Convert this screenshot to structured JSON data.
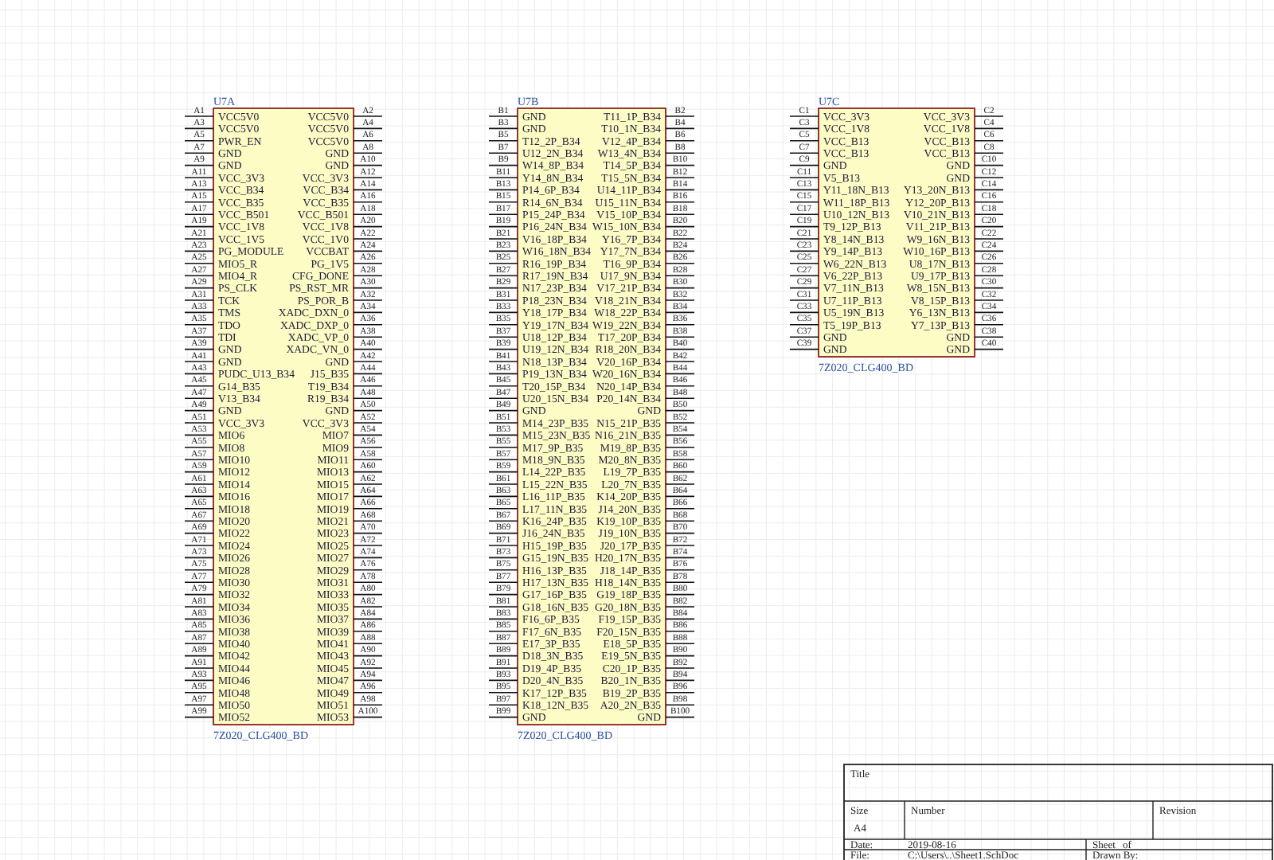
{
  "parts": [
    {
      "designator": "U7A",
      "footprint": "7Z020_CLG400_BD",
      "rows": [
        {
          "pin_l": "A1",
          "name_l": "VCC5V0",
          "name_r": "VCC5V0",
          "pin_r": "A2"
        },
        {
          "pin_l": "A3",
          "name_l": "VCC5V0",
          "name_r": "VCC5V0",
          "pin_r": "A4"
        },
        {
          "pin_l": "A5",
          "name_l": "PWR_EN",
          "name_r": "VCC5V0",
          "pin_r": "A6"
        },
        {
          "pin_l": "A7",
          "name_l": "GND",
          "name_r": "GND",
          "pin_r": "A8"
        },
        {
          "pin_l": "A9",
          "name_l": "GND",
          "name_r": "GND",
          "pin_r": "A10"
        },
        {
          "pin_l": "A11",
          "name_l": "VCC_3V3",
          "name_r": "VCC_3V3",
          "pin_r": "A12"
        },
        {
          "pin_l": "A13",
          "name_l": "VCC_B34",
          "name_r": "VCC_B34",
          "pin_r": "A14"
        },
        {
          "pin_l": "A15",
          "name_l": "VCC_B35",
          "name_r": "VCC_B35",
          "pin_r": "A16"
        },
        {
          "pin_l": "A17",
          "name_l": "VCC_B501",
          "name_r": "VCC_B501",
          "pin_r": "A18"
        },
        {
          "pin_l": "A19",
          "name_l": "VCC_1V8",
          "name_r": "VCC_1V8",
          "pin_r": "A20"
        },
        {
          "pin_l": "A21",
          "name_l": "VCC_1V5",
          "name_r": "VCC_1V0",
          "pin_r": "A22"
        },
        {
          "pin_l": "A23",
          "name_l": "PG_MODULE",
          "name_r": "VCCBAT",
          "pin_r": "A24"
        },
        {
          "pin_l": "A25",
          "name_l": "MIO5_R",
          "name_r": "PG_1V5",
          "pin_r": "A26"
        },
        {
          "pin_l": "A27",
          "name_l": "MIO4_R",
          "name_r": "CFG_DONE",
          "pin_r": "A28"
        },
        {
          "pin_l": "A29",
          "name_l": "PS_CLK",
          "name_r": "PS_RST_MR",
          "pin_r": "A30"
        },
        {
          "pin_l": "A31",
          "name_l": "TCK",
          "name_r": "PS_POR_B",
          "pin_r": "A32"
        },
        {
          "pin_l": "A33",
          "name_l": "TMS",
          "name_r": "XADC_DXN_0",
          "pin_r": "A34"
        },
        {
          "pin_l": "A35",
          "name_l": "TDO",
          "name_r": "XADC_DXP_0",
          "pin_r": "A36"
        },
        {
          "pin_l": "A37",
          "name_l": "TDI",
          "name_r": "XADC_VP_0",
          "pin_r": "A38"
        },
        {
          "pin_l": "A39",
          "name_l": "GND",
          "name_r": "XADC_VN_0",
          "pin_r": "A40"
        },
        {
          "pin_l": "A41",
          "name_l": "GND",
          "name_r": "GND",
          "pin_r": "A42"
        },
        {
          "pin_l": "A43",
          "name_l": "PUDC_U13_B34",
          "name_r": "J15_B35",
          "pin_r": "A44"
        },
        {
          "pin_l": "A45",
          "name_l": "G14_B35",
          "name_r": "T19_B34",
          "pin_r": "A46"
        },
        {
          "pin_l": "A47",
          "name_l": "V13_B34",
          "name_r": "R19_B34",
          "pin_r": "A48"
        },
        {
          "pin_l": "A49",
          "name_l": "GND",
          "name_r": "GND",
          "pin_r": "A50"
        },
        {
          "pin_l": "A51",
          "name_l": "VCC_3V3",
          "name_r": "VCC_3V3",
          "pin_r": "A52"
        },
        {
          "pin_l": "A53",
          "name_l": "MIO6",
          "name_r": "MIO7",
          "pin_r": "A54"
        },
        {
          "pin_l": "A55",
          "name_l": "MIO8",
          "name_r": "MIO9",
          "pin_r": "A56"
        },
        {
          "pin_l": "A57",
          "name_l": "MIO10",
          "name_r": "MIO11",
          "pin_r": "A58"
        },
        {
          "pin_l": "A59",
          "name_l": "MIO12",
          "name_r": "MIO13",
          "pin_r": "A60"
        },
        {
          "pin_l": "A61",
          "name_l": "MIO14",
          "name_r": "MIO15",
          "pin_r": "A62"
        },
        {
          "pin_l": "A63",
          "name_l": "MIO16",
          "name_r": "MIO17",
          "pin_r": "A64"
        },
        {
          "pin_l": "A65",
          "name_l": "MIO18",
          "name_r": "MIO19",
          "pin_r": "A66"
        },
        {
          "pin_l": "A67",
          "name_l": "MIO20",
          "name_r": "MIO21",
          "pin_r": "A68"
        },
        {
          "pin_l": "A69",
          "name_l": "MIO22",
          "name_r": "MIO23",
          "pin_r": "A70"
        },
        {
          "pin_l": "A71",
          "name_l": "MIO24",
          "name_r": "MIO25",
          "pin_r": "A72"
        },
        {
          "pin_l": "A73",
          "name_l": "MIO26",
          "name_r": "MIO27",
          "pin_r": "A74"
        },
        {
          "pin_l": "A75",
          "name_l": "MIO28",
          "name_r": "MIO29",
          "pin_r": "A76"
        },
        {
          "pin_l": "A77",
          "name_l": "MIO30",
          "name_r": "MIO31",
          "pin_r": "A78"
        },
        {
          "pin_l": "A79",
          "name_l": "MIO32",
          "name_r": "MIO33",
          "pin_r": "A80"
        },
        {
          "pin_l": "A81",
          "name_l": "MIO34",
          "name_r": "MIO35",
          "pin_r": "A82"
        },
        {
          "pin_l": "A83",
          "name_l": "MIO36",
          "name_r": "MIO37",
          "pin_r": "A84"
        },
        {
          "pin_l": "A85",
          "name_l": "MIO38",
          "name_r": "MIO39",
          "pin_r": "A86"
        },
        {
          "pin_l": "A87",
          "name_l": "MIO40",
          "name_r": "MIO41",
          "pin_r": "A88"
        },
        {
          "pin_l": "A89",
          "name_l": "MIO42",
          "name_r": "MIO43",
          "pin_r": "A90"
        },
        {
          "pin_l": "A91",
          "name_l": "MIO44",
          "name_r": "MIO45",
          "pin_r": "A92"
        },
        {
          "pin_l": "A93",
          "name_l": "MIO46",
          "name_r": "MIO47",
          "pin_r": "A94"
        },
        {
          "pin_l": "A95",
          "name_l": "MIO48",
          "name_r": "MIO49",
          "pin_r": "A96"
        },
        {
          "pin_l": "A97",
          "name_l": "MIO50",
          "name_r": "MIO51",
          "pin_r": "A98"
        },
        {
          "pin_l": "A99",
          "name_l": "MIO52",
          "name_r": "MIO53",
          "pin_r": "A100"
        }
      ]
    },
    {
      "designator": "U7B",
      "footprint": "7Z020_CLG400_BD",
      "rows": [
        {
          "pin_l": "B1",
          "name_l": "GND",
          "name_r": "T11_1P_B34",
          "pin_r": "B2"
        },
        {
          "pin_l": "B3",
          "name_l": "GND",
          "name_r": "T10_1N_B34",
          "pin_r": "B4"
        },
        {
          "pin_l": "B5",
          "name_l": "T12_2P_B34",
          "name_r": "V12_4P_B34",
          "pin_r": "B6"
        },
        {
          "pin_l": "B7",
          "name_l": "U12_2N_B34",
          "name_r": "W13_4N_B34",
          "pin_r": "B8"
        },
        {
          "pin_l": "B9",
          "name_l": "W14_8P_B34",
          "name_r": "T14_5P_B34",
          "pin_r": "B10"
        },
        {
          "pin_l": "B11",
          "name_l": "Y14_8N_B34",
          "name_r": "T15_5N_B34",
          "pin_r": "B12"
        },
        {
          "pin_l": "B13",
          "name_l": "P14_6P_B34",
          "name_r": "U14_11P_B34",
          "pin_r": "B14"
        },
        {
          "pin_l": "B15",
          "name_l": "R14_6N_B34",
          "name_r": "U15_11N_B34",
          "pin_r": "B16"
        },
        {
          "pin_l": "B17",
          "name_l": "P15_24P_B34",
          "name_r": "V15_10P_B34",
          "pin_r": "B18"
        },
        {
          "pin_l": "B19",
          "name_l": "P16_24N_B34",
          "name_r": "W15_10N_B34",
          "pin_r": "B20"
        },
        {
          "pin_l": "B21",
          "name_l": "V16_18P_B34",
          "name_r": "Y16_7P_B34",
          "pin_r": "B22"
        },
        {
          "pin_l": "B23",
          "name_l": "W16_18N_B34",
          "name_r": "Y17_7N_B34",
          "pin_r": "B24"
        },
        {
          "pin_l": "B25",
          "name_l": "R16_19P_B34",
          "name_r": "T16_9P_B34",
          "pin_r": "B26"
        },
        {
          "pin_l": "B27",
          "name_l": "R17_19N_B34",
          "name_r": "U17_9N_B34",
          "pin_r": "B28"
        },
        {
          "pin_l": "B29",
          "name_l": "N17_23P_B34",
          "name_r": "V17_21P_B34",
          "pin_r": "B30"
        },
        {
          "pin_l": "B31",
          "name_l": "P18_23N_B34",
          "name_r": "V18_21N_B34",
          "pin_r": "B32"
        },
        {
          "pin_l": "B33",
          "name_l": "Y18_17P_B34",
          "name_r": "W18_22P_B34",
          "pin_r": "B34"
        },
        {
          "pin_l": "B35",
          "name_l": "Y19_17N_B34",
          "name_r": "W19_22N_B34",
          "pin_r": "B36"
        },
        {
          "pin_l": "B37",
          "name_l": "U18_12P_B34",
          "name_r": "T17_20P_B34",
          "pin_r": "B38"
        },
        {
          "pin_l": "B39",
          "name_l": "U19_12N_B34",
          "name_r": "R18_20N_B34",
          "pin_r": "B40"
        },
        {
          "pin_l": "B41",
          "name_l": "N18_13P_B34",
          "name_r": "V20_16P_B34",
          "pin_r": "B42"
        },
        {
          "pin_l": "B43",
          "name_l": "P19_13N_B34",
          "name_r": "W20_16N_B34",
          "pin_r": "B44"
        },
        {
          "pin_l": "B45",
          "name_l": "T20_15P_B34",
          "name_r": "N20_14P_B34",
          "pin_r": "B46"
        },
        {
          "pin_l": "B47",
          "name_l": "U20_15N_B34",
          "name_r": "P20_14N_B34",
          "pin_r": "B48"
        },
        {
          "pin_l": "B49",
          "name_l": "GND",
          "name_r": "GND",
          "pin_r": "B50"
        },
        {
          "pin_l": "B51",
          "name_l": "M14_23P_B35",
          "name_r": "N15_21P_B35",
          "pin_r": "B52"
        },
        {
          "pin_l": "B53",
          "name_l": "M15_23N_B35",
          "name_r": "N16_21N_B35",
          "pin_r": "B54"
        },
        {
          "pin_l": "B55",
          "name_l": "M17_9P_B35",
          "name_r": "M19_8P_B35",
          "pin_r": "B56"
        },
        {
          "pin_l": "B57",
          "name_l": "M18_9N_B35",
          "name_r": "M20_8N_B35",
          "pin_r": "B58"
        },
        {
          "pin_l": "B59",
          "name_l": "L14_22P_B35",
          "name_r": "L19_7P_B35",
          "pin_r": "B60"
        },
        {
          "pin_l": "B61",
          "name_l": "L15_22N_B35",
          "name_r": "L20_7N_B35",
          "pin_r": "B62"
        },
        {
          "pin_l": "B63",
          "name_l": "L16_11P_B35",
          "name_r": "K14_20P_B35",
          "pin_r": "B64"
        },
        {
          "pin_l": "B65",
          "name_l": "L17_11N_B35",
          "name_r": "J14_20N_B35",
          "pin_r": "B66"
        },
        {
          "pin_l": "B67",
          "name_l": "K16_24P_B35",
          "name_r": "K19_10P_B35",
          "pin_r": "B68"
        },
        {
          "pin_l": "B69",
          "name_l": "J16_24N_B35",
          "name_r": "J19_10N_B35",
          "pin_r": "B70"
        },
        {
          "pin_l": "B71",
          "name_l": "H15_19P_B35",
          "name_r": "J20_17P_B35",
          "pin_r": "B72"
        },
        {
          "pin_l": "B73",
          "name_l": "G15_19N_B35",
          "name_r": "H20_17N_B35",
          "pin_r": "B74"
        },
        {
          "pin_l": "B75",
          "name_l": "H16_13P_B35",
          "name_r": "J18_14P_B35",
          "pin_r": "B76"
        },
        {
          "pin_l": "B77",
          "name_l": "H17_13N_B35",
          "name_r": "H18_14N_B35",
          "pin_r": "B78"
        },
        {
          "pin_l": "B79",
          "name_l": "G17_16P_B35",
          "name_r": "G19_18P_B35",
          "pin_r": "B80"
        },
        {
          "pin_l": "B81",
          "name_l": "G18_16N_B35",
          "name_r": "G20_18N_B35",
          "pin_r": "B82"
        },
        {
          "pin_l": "B83",
          "name_l": "F16_6P_B35",
          "name_r": "F19_15P_B35",
          "pin_r": "B84"
        },
        {
          "pin_l": "B85",
          "name_l": "F17_6N_B35",
          "name_r": "F20_15N_B35",
          "pin_r": "B86"
        },
        {
          "pin_l": "B87",
          "name_l": "E17_3P_B35",
          "name_r": "E18_5P_B35",
          "pin_r": "B88"
        },
        {
          "pin_l": "B89",
          "name_l": "D18_3N_B35",
          "name_r": "E19_5N_B35",
          "pin_r": "B90"
        },
        {
          "pin_l": "B91",
          "name_l": "D19_4P_B35",
          "name_r": "C20_1P_B35",
          "pin_r": "B92"
        },
        {
          "pin_l": "B93",
          "name_l": "D20_4N_B35",
          "name_r": "B20_1N_B35",
          "pin_r": "B94"
        },
        {
          "pin_l": "B95",
          "name_l": "K17_12P_B35",
          "name_r": "B19_2P_B35",
          "pin_r": "B96"
        },
        {
          "pin_l": "B97",
          "name_l": "K18_12N_B35",
          "name_r": "A20_2N_B35",
          "pin_r": "B98"
        },
        {
          "pin_l": "B99",
          "name_l": "GND",
          "name_r": "GND",
          "pin_r": "B100"
        }
      ]
    },
    {
      "designator": "U7C",
      "footprint": "7Z020_CLG400_BD",
      "rows": [
        {
          "pin_l": "C1",
          "name_l": "VCC_3V3",
          "name_r": "VCC_3V3",
          "pin_r": "C2"
        },
        {
          "pin_l": "C3",
          "name_l": "VCC_1V8",
          "name_r": "VCC_1V8",
          "pin_r": "C4"
        },
        {
          "pin_l": "C5",
          "name_l": "VCC_B13",
          "name_r": "VCC_B13",
          "pin_r": "C6"
        },
        {
          "pin_l": "C7",
          "name_l": "VCC_B13",
          "name_r": "VCC_B13",
          "pin_r": "C8"
        },
        {
          "pin_l": "C9",
          "name_l": "GND",
          "name_r": "GND",
          "pin_r": "C10"
        },
        {
          "pin_l": "C11",
          "name_l": "V5_B13",
          "name_r": "GND",
          "pin_r": "C12"
        },
        {
          "pin_l": "C13",
          "name_l": "Y11_18N_B13",
          "name_r": "Y13_20N_B13",
          "pin_r": "C14"
        },
        {
          "pin_l": "C15",
          "name_l": "W11_18P_B13",
          "name_r": "Y12_20P_B13",
          "pin_r": "C16"
        },
        {
          "pin_l": "C17",
          "name_l": "U10_12N_B13",
          "name_r": "V10_21N_B13",
          "pin_r": "C18"
        },
        {
          "pin_l": "C19",
          "name_l": "T9_12P_B13",
          "name_r": "V11_21P_B13",
          "pin_r": "C20"
        },
        {
          "pin_l": "C21",
          "name_l": "Y8_14N_B13",
          "name_r": "W9_16N_B13",
          "pin_r": "C22"
        },
        {
          "pin_l": "C23",
          "name_l": "Y9_14P_B13",
          "name_r": "W10_16P_B13",
          "pin_r": "C24"
        },
        {
          "pin_l": "C25",
          "name_l": "W6_22N_B13",
          "name_r": "U8_17N_B13",
          "pin_r": "C26"
        },
        {
          "pin_l": "C27",
          "name_l": "V6_22P_B13",
          "name_r": "U9_17P_B13",
          "pin_r": "C28"
        },
        {
          "pin_l": "C29",
          "name_l": "V7_11N_B13",
          "name_r": "W8_15N_B13",
          "pin_r": "C30"
        },
        {
          "pin_l": "C31",
          "name_l": "U7_11P_B13",
          "name_r": "V8_15P_B13",
          "pin_r": "C32"
        },
        {
          "pin_l": "C33",
          "name_l": "U5_19N_B13",
          "name_r": "Y6_13N_B13",
          "pin_r": "C34"
        },
        {
          "pin_l": "C35",
          "name_l": "T5_19P_B13",
          "name_r": "Y7_13P_B13",
          "pin_r": "C36"
        },
        {
          "pin_l": "C37",
          "name_l": "GND",
          "name_r": "GND",
          "pin_r": "C38"
        },
        {
          "pin_l": "C39",
          "name_l": "GND",
          "name_r": "GND",
          "pin_r": "C40"
        }
      ]
    }
  ],
  "title_block": {
    "title_label": "Title",
    "size_label": "Size",
    "size": "A4",
    "number_label": "Number",
    "revision_label": "Revision",
    "date_label": "Date:",
    "date": "2019-08-16",
    "sheet_label": "Sheet",
    "of_label": "of",
    "file_label": "File:",
    "file": "C:\\Users\\..\\Sheet1.SchDoc",
    "drawn_by_label": "Drawn By:"
  }
}
